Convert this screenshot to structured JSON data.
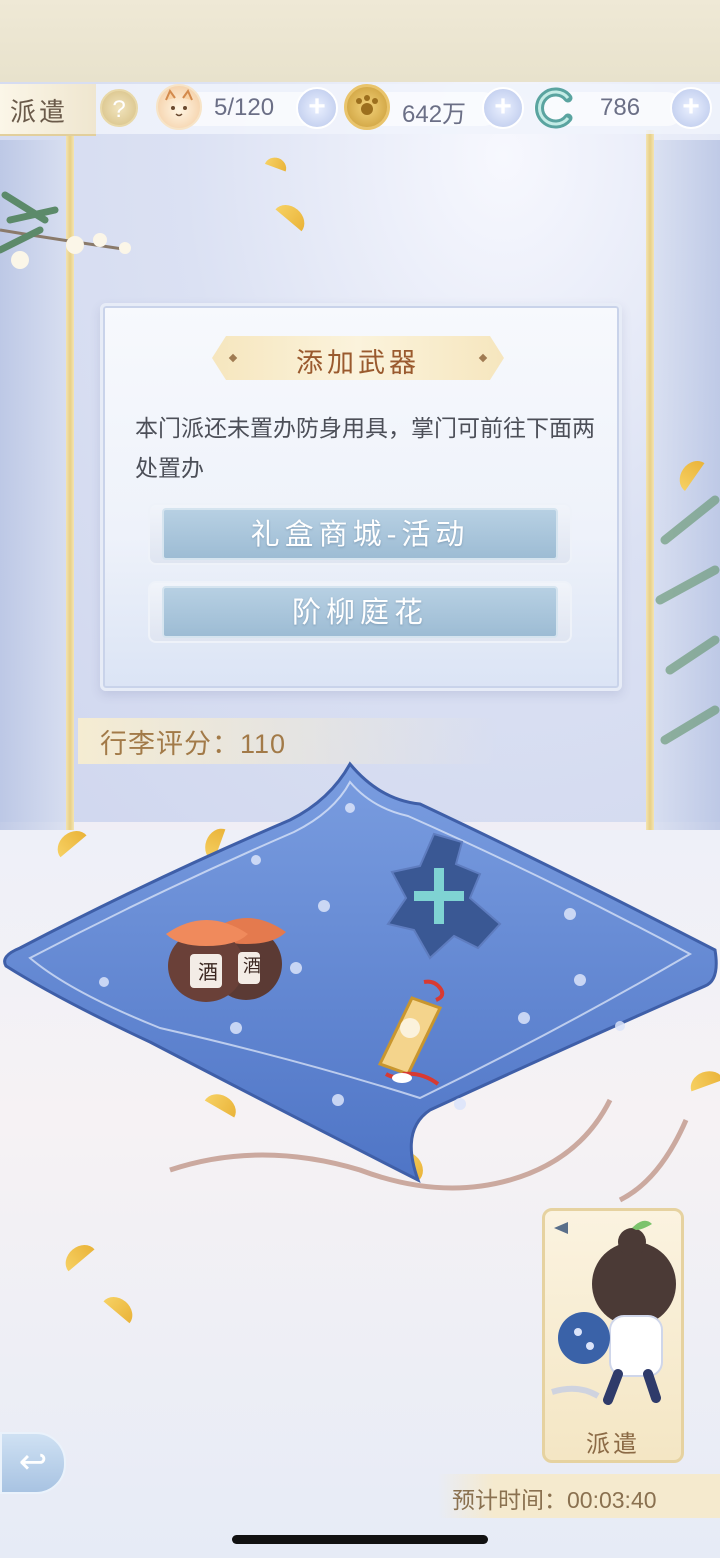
{
  "header": {
    "title": "派遣",
    "help_icon": "question-icon",
    "resources": [
      {
        "icon": "cat-icon",
        "value": "5/120"
      },
      {
        "icon": "coin-icon",
        "value": "642万"
      },
      {
        "icon": "jade-icon",
        "value": "786"
      }
    ],
    "plus_label": "+"
  },
  "dialog": {
    "title": "添加武器",
    "message": "本门派还未置办防身用具，掌门可前往下面两处置办",
    "buttons": [
      {
        "label": "礼盒商城-活动"
      },
      {
        "label": "阶柳庭花"
      }
    ]
  },
  "luggage": {
    "score_label": "行李评分：110",
    "items": [
      "wine-jars",
      "empty-weapon-slot",
      "tassel-pendant"
    ],
    "wine_char": "酒"
  },
  "dispatch_card": {
    "label": "派遣"
  },
  "estimate": {
    "label": "预计时间：00:03:40"
  },
  "colors": {
    "carpet": "#5f86d2",
    "accent_gold": "#e8cf86",
    "button_blue": "#a9c5db",
    "score_text": "#a27a48"
  }
}
